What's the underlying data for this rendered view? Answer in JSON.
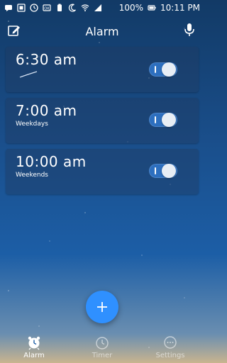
{
  "status_bar": {
    "left_icons": [
      "chat-bubble-icon",
      "notification-badge-icon",
      "clock-face-icon",
      "battery-saver-icon",
      "moon-icon",
      "wifi-icon",
      "signal-icon"
    ],
    "battery_text": "100%",
    "time": "10:11 PM"
  },
  "header": {
    "title": "Alarm",
    "left_icon": "edit-icon",
    "right_icon": "microphone-icon"
  },
  "alarms": [
    {
      "time": "6:30 am",
      "label": "",
      "enabled": true
    },
    {
      "time": "7:00 am",
      "label": "Weekdays",
      "enabled": true
    },
    {
      "time": "10:00 am",
      "label": "Weekends",
      "enabled": true
    }
  ],
  "fab": {
    "icon": "plus-icon"
  },
  "bottom_nav": {
    "items": [
      {
        "label": "Alarm",
        "icon": "alarm-clock-icon",
        "active": true
      },
      {
        "label": "Timer",
        "icon": "stopwatch-icon",
        "active": false
      },
      {
        "label": "Settings",
        "icon": "more-dots-icon",
        "active": false
      }
    ]
  },
  "colors": {
    "accent": "#2f90ff",
    "toggle_on": "#2d6fbf",
    "background_top": "#123a66",
    "background_bottom": "#c9b48f"
  }
}
